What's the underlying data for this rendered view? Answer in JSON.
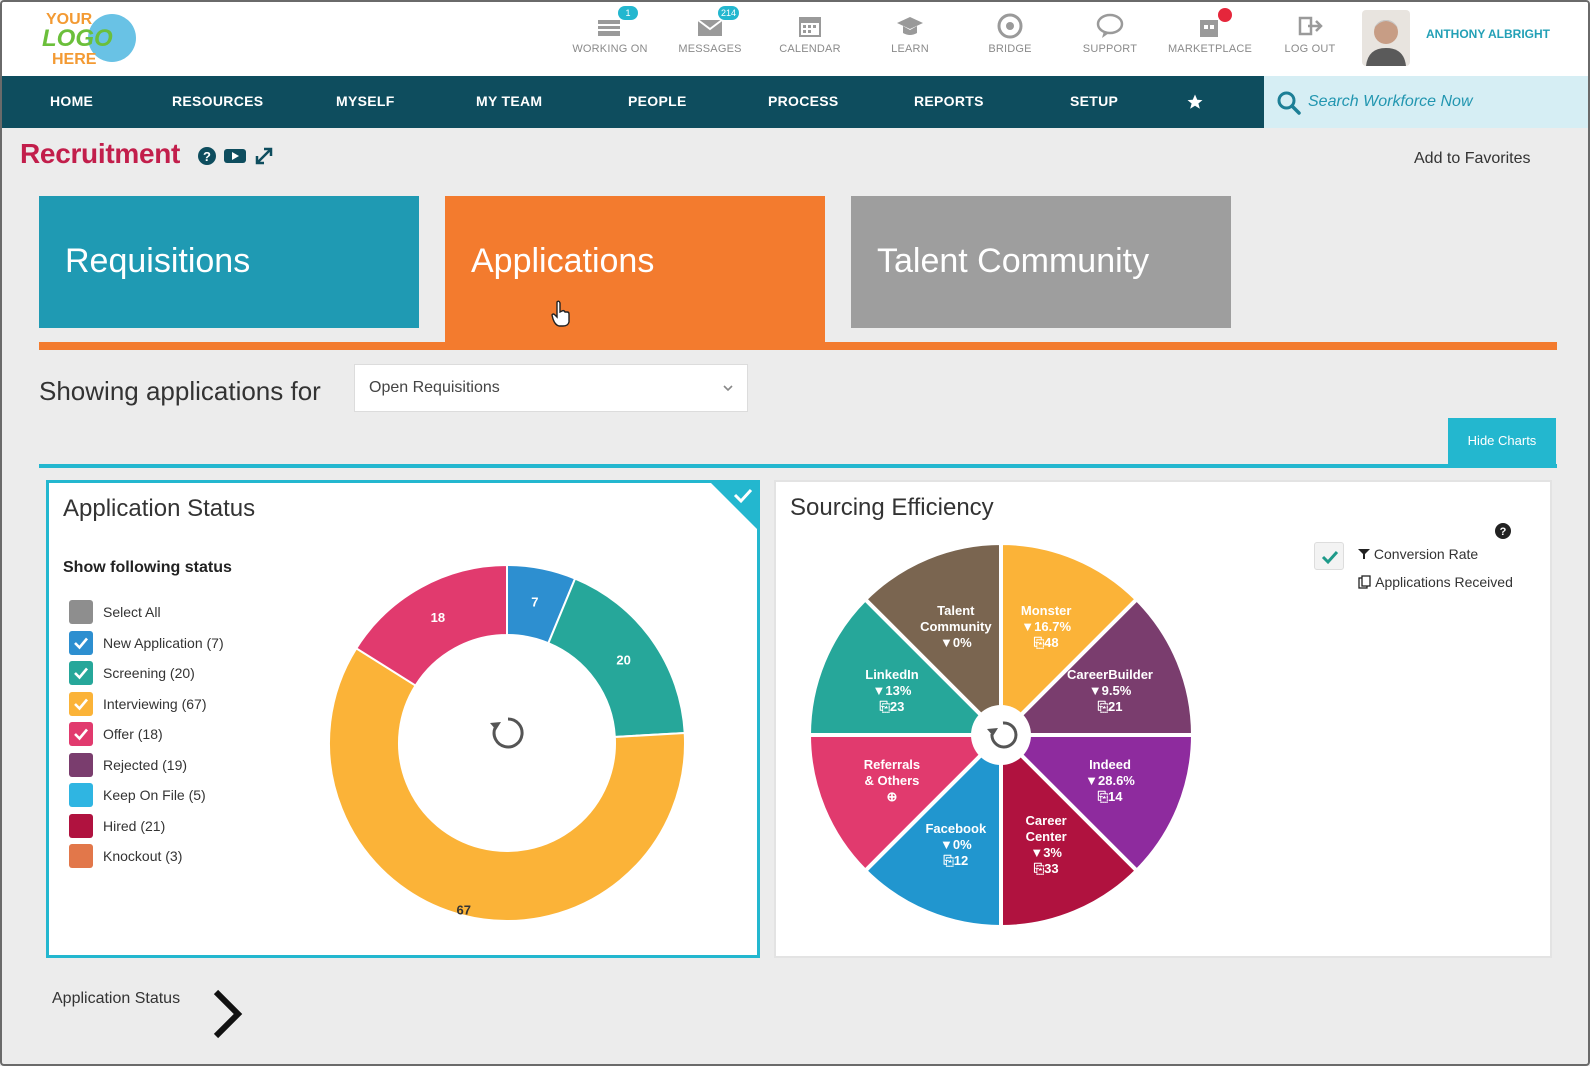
{
  "header": {
    "logo_text": [
      "YOUR",
      "LOGO",
      "HERE"
    ],
    "items": [
      {
        "label": "WORKING ON",
        "icon": "briefcase-icon",
        "badge": "1"
      },
      {
        "label": "MESSAGES",
        "icon": "envelope-icon",
        "badge": "214"
      },
      {
        "label": "CALENDAR",
        "icon": "calendar-icon",
        "badge": ""
      },
      {
        "label": "LEARN",
        "icon": "graduation-cap-icon",
        "badge": ""
      },
      {
        "label": "BRIDGE",
        "icon": "bridge-icon",
        "badge": ""
      },
      {
        "label": "SUPPORT",
        "icon": "chat-bubble-icon",
        "badge": ""
      },
      {
        "label": "MARKETPLACE",
        "icon": "marketplace-icon",
        "badge": ""
      },
      {
        "label": "LOG OUT",
        "icon": "logout-icon",
        "badge": ""
      }
    ],
    "user_name": "ANTHONY ALBRIGHT"
  },
  "nav": {
    "items": [
      "HOME",
      "RESOURCES",
      "MYSELF",
      "MY TEAM",
      "PEOPLE",
      "PROCESS",
      "REPORTS",
      "SETUP"
    ],
    "search_placeholder": "Search Workforce Now"
  },
  "page": {
    "title": "Recruitment",
    "add_favorites": "Add to Favorites",
    "tiles": {
      "requisitions": "Requisitions",
      "applications": "Applications",
      "talent": "Talent Community"
    },
    "showing_label": "Showing applications for",
    "select_value": "Open Requisitions",
    "hide_charts": "Hide Charts",
    "bottom_label": "Application Status"
  },
  "status_panel": {
    "title": "Application Status",
    "show_following": "Show following status",
    "legend": [
      {
        "label": "Select All",
        "color": "#8e8e8e",
        "checked": false
      },
      {
        "label": "New Application (7)",
        "color": "#2d8fd0",
        "checked": true
      },
      {
        "label": "Screening (20)",
        "color": "#26a79a",
        "checked": true
      },
      {
        "label": "Interviewing (67)",
        "color": "#fbb338",
        "checked": true
      },
      {
        "label": "Offer (18)",
        "color": "#e13a6e",
        "checked": true
      },
      {
        "label": "Rejected (19)",
        "color": "#7a3d6e",
        "checked": false
      },
      {
        "label": "Keep On File (5)",
        "color": "#2fb5e2",
        "checked": false
      },
      {
        "label": "Hired (21)",
        "color": "#b0123f",
        "checked": false
      },
      {
        "label": "Knockout (3)",
        "color": "#e2774a",
        "checked": false
      }
    ]
  },
  "sourcing_panel": {
    "title": "Sourcing Efficiency",
    "conversion_rate": "Conversion Rate",
    "applications_received": "Applications Received"
  },
  "chart_data": [
    {
      "type": "pie",
      "title": "Application Status",
      "categories": [
        "New Application",
        "Screening",
        "Interviewing",
        "Offer"
      ],
      "values": [
        7,
        20,
        67,
        18
      ],
      "labels": [
        "7",
        "20",
        "67",
        "18"
      ],
      "colors": [
        "#2d8fd0",
        "#26a79a",
        "#fbb338",
        "#e13a6e"
      ],
      "donut": true
    },
    {
      "type": "pie",
      "title": "Sourcing Efficiency",
      "categories": [
        "Monster",
        "CareerBuilder",
        "Indeed",
        "Career Center",
        "Facebook",
        "Referrals & Others",
        "LinkedIn",
        "Talent Community"
      ],
      "lines": [
        [
          "Monster",
          "▼16.7%",
          "⎘48"
        ],
        [
          "CareerBuilder",
          "▼9.5%",
          "⎘21"
        ],
        [
          "Indeed",
          "▼28.6%",
          "⎘14"
        ],
        [
          "Career",
          "Center",
          "▼3%",
          "⎘33"
        ],
        [
          "Facebook",
          "▼0%",
          "⎘12"
        ],
        [
          "Referrals",
          "& Others",
          "⊕"
        ],
        [
          "LinkedIn",
          "▼13%",
          "⎘23"
        ],
        [
          "Talent",
          "Community",
          "▼0%"
        ]
      ],
      "conversion_rate_pct": [
        16.7,
        9.5,
        28.6,
        3,
        0,
        null,
        13,
        0
      ],
      "applications_received": [
        48,
        21,
        14,
        33,
        12,
        null,
        23,
        null
      ],
      "colors": [
        "#fbb338",
        "#7a3d6e",
        "#8e2b9e",
        "#b0123f",
        "#2196cf",
        "#e13a6e",
        "#26a79a",
        "#7a6550"
      ]
    }
  ]
}
